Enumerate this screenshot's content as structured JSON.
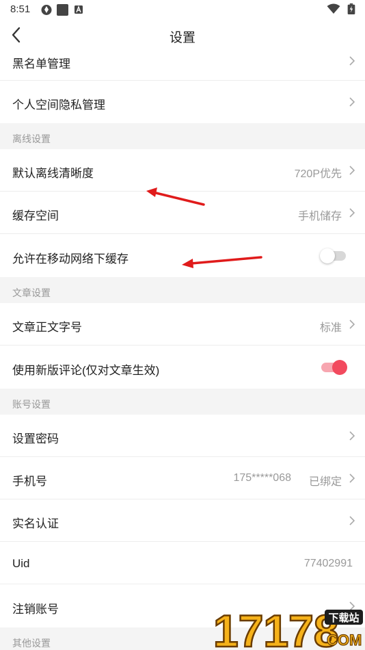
{
  "status_bar": {
    "time": "8:51"
  },
  "header": {
    "title": "设置"
  },
  "rows": {
    "blacklist": {
      "label": "黑名单管理"
    },
    "privacy": {
      "label": "个人空间隐私管理"
    },
    "offline_quality": {
      "label": "默认离线清晰度",
      "value": "720P优先"
    },
    "cache_space": {
      "label": "缓存空间",
      "value": "手机储存"
    },
    "mobile_cache": {
      "label": "允许在移动网络下缓存",
      "toggle": false
    },
    "font_size": {
      "label": "文章正文字号",
      "value": "标准"
    },
    "new_comment": {
      "label": "使用新版评论(仅对文章生效)",
      "toggle": true
    },
    "set_password": {
      "label": "设置密码"
    },
    "phone": {
      "label": "手机号",
      "number": "175*****068",
      "value": "已绑定"
    },
    "real_name": {
      "label": "实名认证"
    },
    "uid": {
      "label": "Uid",
      "value": "77402991"
    },
    "delete_account": {
      "label": "注销账号"
    }
  },
  "sections": {
    "offline": "离线设置",
    "article": "文章设置",
    "account": "账号设置",
    "other": "其他设置"
  },
  "watermark": {
    "text": "17178",
    "badge": "下载站",
    "domain": "COM"
  },
  "colors": {
    "accent": "#f24a5e",
    "annotation": "#e01b1b"
  }
}
